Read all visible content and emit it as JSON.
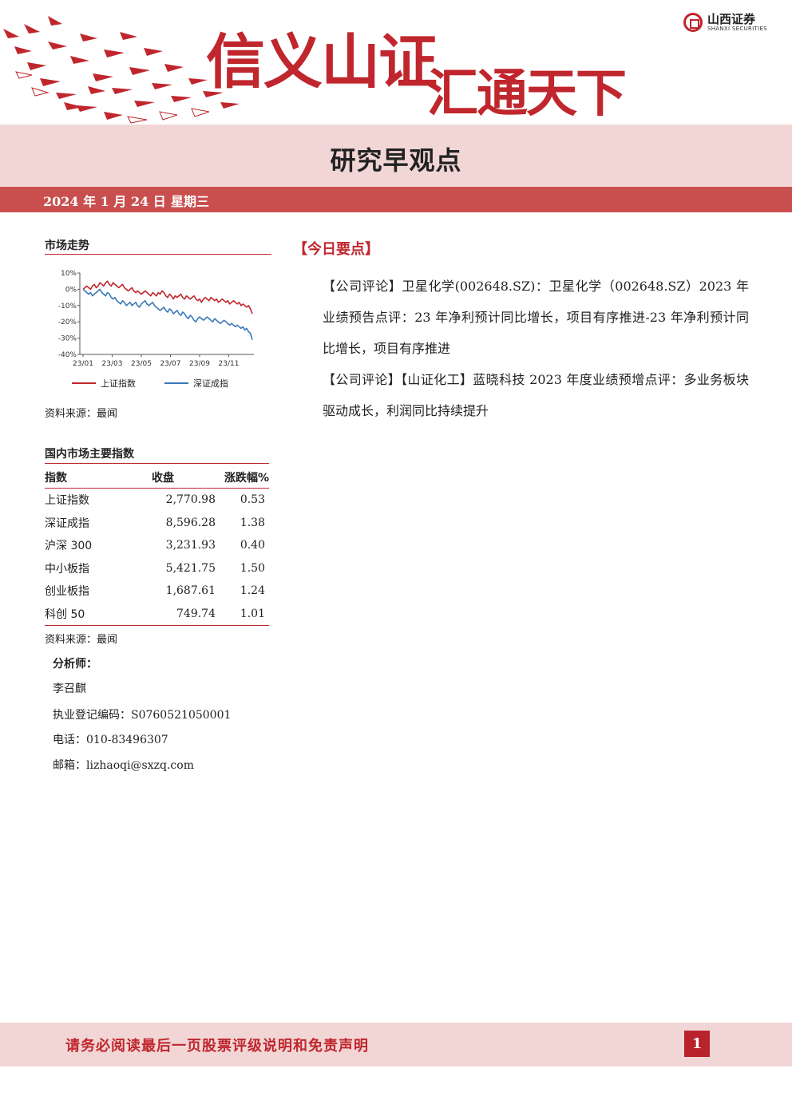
{
  "header": {
    "slogan_left": "信义山证",
    "slogan_right": "汇通天下",
    "logo_cn": "山西证券",
    "logo_en": "SHANXI SECURITIES",
    "brand_color": "#c0262d"
  },
  "report_title": "研究早观点",
  "date": "2024 年 1 月 24 日",
  "weekday": "星期三",
  "market_trend": {
    "heading": "市场走势",
    "source": "资料来源：最闻"
  },
  "chart_data": {
    "type": "line",
    "title": "",
    "y_ticks": [
      "10%",
      "0%",
      "-10%",
      "-20%",
      "-30%",
      "-40%"
    ],
    "x_ticks": [
      "23/01",
      "23/03",
      "23/05",
      "23/07",
      "23/09",
      "23/11"
    ],
    "ylim": [
      -40,
      10
    ],
    "legend_position": "bottom",
    "series": [
      {
        "name": "上证指数",
        "color": "#c0262d",
        "x": [
          0,
          4,
          8,
          12,
          16,
          20,
          24,
          28,
          32,
          36,
          40,
          44,
          48,
          52,
          56,
          60,
          64,
          68,
          72,
          76,
          80,
          84,
          88,
          92,
          96,
          100,
          104,
          108,
          112,
          116,
          120,
          124,
          128,
          132,
          136,
          140,
          144,
          148,
          152,
          156,
          160,
          164,
          168,
          172,
          176,
          180,
          184,
          188,
          192,
          196,
          200,
          204,
          208,
          212,
          216,
          220,
          224,
          228,
          232,
          236,
          240,
          244,
          248,
          252,
          256,
          260,
          264,
          268,
          272,
          276,
          280,
          284,
          288,
          292,
          296,
          300,
          304,
          308,
          312,
          316,
          320,
          324,
          328,
          332,
          336,
          340,
          344,
          348,
          352,
          356,
          360
        ],
        "values": [
          0,
          1,
          2,
          1,
          0,
          2,
          3,
          1,
          2,
          4,
          3,
          2,
          4,
          5,
          3,
          2,
          4,
          3,
          2,
          1,
          2,
          3,
          1,
          0,
          -1,
          0,
          1,
          -1,
          -2,
          -1,
          -2,
          -3,
          -2,
          -1,
          -2,
          -3,
          -4,
          -2,
          -3,
          -4,
          -2,
          -3,
          -1,
          -2,
          -4,
          -5,
          -3,
          -4,
          -6,
          -4,
          -5,
          -4,
          -3,
          -5,
          -6,
          -4,
          -5,
          -6,
          -5,
          -4,
          -6,
          -7,
          -6,
          -8,
          -6,
          -5,
          -6,
          -7,
          -5,
          -6,
          -7,
          -6,
          -8,
          -7,
          -6,
          -7,
          -8,
          -7,
          -9,
          -8,
          -7,
          -8,
          -9,
          -8,
          -10,
          -9,
          -10,
          -11,
          -10,
          -12,
          -15
        ]
      },
      {
        "name": "深证成指",
        "color": "#3a78b8",
        "x": [
          0,
          4,
          8,
          12,
          16,
          20,
          24,
          28,
          32,
          36,
          40,
          44,
          48,
          52,
          56,
          60,
          64,
          68,
          72,
          76,
          80,
          84,
          88,
          92,
          96,
          100,
          104,
          108,
          112,
          116,
          120,
          124,
          128,
          132,
          136,
          140,
          144,
          148,
          152,
          156,
          160,
          164,
          168,
          172,
          176,
          180,
          184,
          188,
          192,
          196,
          200,
          204,
          208,
          212,
          216,
          220,
          224,
          228,
          232,
          236,
          240,
          244,
          248,
          252,
          256,
          260,
          264,
          268,
          272,
          276,
          280,
          284,
          288,
          292,
          296,
          300,
          304,
          308,
          312,
          316,
          320,
          324,
          328,
          332,
          336,
          340,
          344,
          348,
          352,
          356,
          360
        ],
        "values": [
          0,
          -1,
          -2,
          -3,
          -2,
          -4,
          -3,
          -2,
          -1,
          0,
          -2,
          -3,
          -4,
          -2,
          -3,
          -5,
          -6,
          -5,
          -7,
          -8,
          -9,
          -7,
          -8,
          -10,
          -9,
          -8,
          -10,
          -9,
          -8,
          -10,
          -11,
          -9,
          -8,
          -7,
          -9,
          -10,
          -9,
          -8,
          -10,
          -11,
          -12,
          -13,
          -12,
          -11,
          -13,
          -14,
          -12,
          -13,
          -15,
          -14,
          -13,
          -15,
          -16,
          -14,
          -15,
          -17,
          -18,
          -16,
          -17,
          -19,
          -20,
          -18,
          -17,
          -18,
          -19,
          -18,
          -17,
          -18,
          -19,
          -20,
          -18,
          -19,
          -20,
          -21,
          -20,
          -19,
          -20,
          -21,
          -22,
          -21,
          -22,
          -23,
          -22,
          -23,
          -24,
          -23,
          -25,
          -24,
          -26,
          -27,
          -31
        ]
      }
    ]
  },
  "indices": {
    "heading": "国内市场主要指数",
    "columns": [
      "指数",
      "收盘",
      "涨跌幅%"
    ],
    "rows": [
      {
        "name": "上证指数",
        "close": "2,770.98",
        "change": "0.53"
      },
      {
        "name": "深证成指",
        "close": "8,596.28",
        "change": "1.38"
      },
      {
        "name": "沪深 300",
        "close": "3,231.93",
        "change": "0.40"
      },
      {
        "name": "中小板指",
        "close": "5,421.75",
        "change": "1.50"
      },
      {
        "name": "创业板指",
        "close": "1,687.61",
        "change": "1.24"
      },
      {
        "name": "科创 50",
        "close": "749.74",
        "change": "1.01"
      }
    ],
    "source": "资料来源：最闻"
  },
  "analyst": {
    "label": "分析师：",
    "name": "李召麒",
    "license": "执业登记编码：S0760521050001",
    "phone": "电话：010-83496307",
    "email": "邮箱：lizhaoqi@sxzq.com"
  },
  "key_points": {
    "heading": "【今日要点】",
    "items": [
      "【公司评论】卫星化学(002648.SZ)：卫星化学（002648.SZ）2023 年业绩预告点评：23 年净利预计同比增长，项目有序推进-23 年净利预计同比增长，项目有序推进",
      "【公司评论】【山证化工】蓝晓科技 2023 年度业绩预增点评：多业务板块驱动成长，利润同比持续提升"
    ]
  },
  "footer": {
    "disclaimer": "请务必阅读最后一页股票评级说明和免责声明",
    "page_number": "1"
  }
}
